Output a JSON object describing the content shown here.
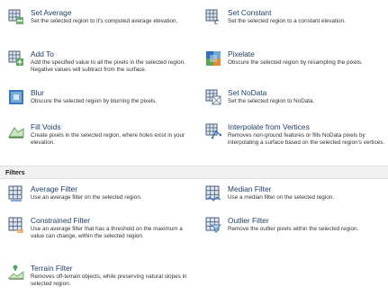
{
  "tools": {
    "set_average": {
      "title": "Set Average",
      "desc": "Set the selected region to it's computed average elevation."
    },
    "set_constant": {
      "title": "Set Constant",
      "desc": "Set the selected region to a constant elevation."
    },
    "add_to": {
      "title": "Add To",
      "desc": "Add the specified value to all the pixels in the selected region. Negative values will subtract from the surface."
    },
    "pixelate": {
      "title": "Pixelate",
      "desc": "Obscure the selected region by resampling the pixels."
    },
    "blur": {
      "title": "Blur",
      "desc": "Obscure the selected region by blurring the pixels."
    },
    "set_nodata": {
      "title": "Set NoData",
      "desc": "Set the selected region to NoData."
    },
    "fill_voids": {
      "title": "Fill Voids",
      "desc": "Create pixels in the selected region, where holes exist in your elevation."
    },
    "interpolate": {
      "title": "Interpolate from Vertices",
      "desc": "Removes non-ground features or fills NoData pixels by interpolating a surface based on the selected region's vertices."
    }
  },
  "filters_header": "Filters",
  "filters": {
    "average": {
      "title": "Average Filter",
      "desc": "Use an average filter on the selected region."
    },
    "median": {
      "title": "Median Filter",
      "desc": "Use a median filter on the selected region."
    },
    "constrained": {
      "title": "Constrained Filter",
      "desc": "Use an average filter that has a threshold on the maximum a value can change, within the selected region."
    },
    "outlier": {
      "title": "Outlier Filter",
      "desc": "Remove the outlier pixels within the selected region."
    },
    "terrain": {
      "title": "Terrain Filter",
      "desc": "Removes off-terrain objects, while preserving natural slopes in selected region."
    }
  },
  "icons": {
    "set_average": "grid-average-icon",
    "set_constant": "grid-constant-icon",
    "add_to": "grid-add-icon",
    "pixelate": "pixelate-icon",
    "blur": "blur-icon",
    "set_nodata": "grid-nodata-icon",
    "fill_voids": "fill-voids-icon",
    "interpolate": "interpolate-vertices-icon",
    "average_filter": "average-filter-icon",
    "median_filter": "median-filter-icon",
    "constrained_filter": "constrained-filter-icon",
    "outlier_filter": "outlier-filter-icon",
    "terrain_filter": "terrain-filter-icon"
  },
  "colors": {
    "title": "#1f3f66",
    "grid": "#4a5d7a",
    "accent_green": "#5aa55a",
    "accent_blue": "#2f6fbf",
    "accent_orange": "#e8892b"
  }
}
